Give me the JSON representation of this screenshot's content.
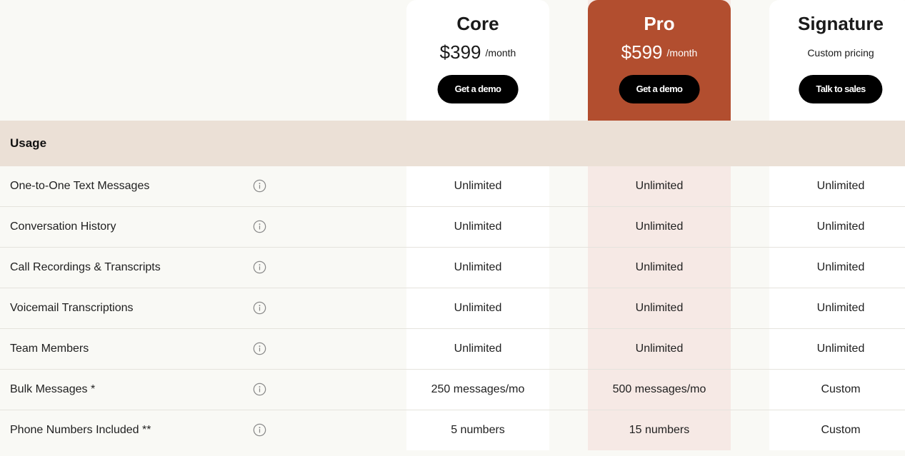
{
  "plans": {
    "core": {
      "name": "Core",
      "price": "$399",
      "period": "/month",
      "cta_label": "Get a demo"
    },
    "pro": {
      "name": "Pro",
      "price": "$599",
      "period": "/month",
      "cta_label": "Get a demo",
      "accent_color": "#b24e2f"
    },
    "signature": {
      "name": "Signature",
      "pricing_text": "Custom pricing",
      "cta_label": "Talk to sales"
    }
  },
  "section": {
    "title": "Usage",
    "band_color": "#ebe0d6"
  },
  "rows": [
    {
      "label": "One-to-One Text Messages",
      "icon": "info-icon",
      "core": "Unlimited",
      "pro": "Unlimited",
      "signature": "Unlimited"
    },
    {
      "label": "Conversation History",
      "icon": "info-icon",
      "core": "Unlimited",
      "pro": "Unlimited",
      "signature": "Unlimited"
    },
    {
      "label": "Call Recordings & Transcripts",
      "icon": "info-icon",
      "core": "Unlimited",
      "pro": "Unlimited",
      "signature": "Unlimited"
    },
    {
      "label": "Voicemail Transcriptions",
      "icon": "info-icon",
      "core": "Unlimited",
      "pro": "Unlimited",
      "signature": "Unlimited"
    },
    {
      "label": "Team Members",
      "icon": "info-icon",
      "core": "Unlimited",
      "pro": "Unlimited",
      "signature": "Unlimited"
    },
    {
      "label": "Bulk Messages *",
      "icon": "info-icon",
      "core": "250 messages/mo",
      "pro": "500 messages/mo",
      "signature": "Custom"
    },
    {
      "label": "Phone Numbers Included **",
      "icon": "info-icon",
      "core": "5 numbers",
      "pro": "15 numbers",
      "signature": "Custom"
    }
  ]
}
